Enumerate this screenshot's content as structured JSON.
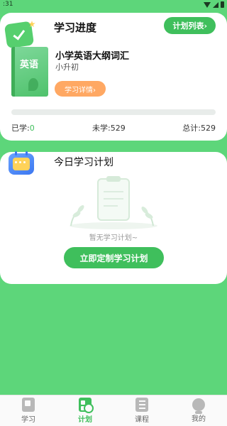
{
  "status_bar": {
    "time": ":31"
  },
  "progress": {
    "title": "学习进度",
    "plan_list_button": "计划列表›",
    "book": {
      "cover_label": "英语",
      "title": "小学英语大纲词汇",
      "subtitle": "小升初",
      "detail_button": "学习详情›"
    },
    "bar_fraction": 0,
    "learned_label": "已学:",
    "learned_value": "0",
    "unlearned": "未学:529",
    "total": "总计:529"
  },
  "plan": {
    "title": "今日学习计划",
    "empty_text": "暂无学习计划~",
    "create_button": "立即定制学习计划"
  },
  "tabs": [
    {
      "label": "学习",
      "icon": "book-icon",
      "active": false
    },
    {
      "label": "计划",
      "icon": "plan-icon",
      "active": true
    },
    {
      "label": "课程",
      "icon": "list-icon",
      "active": false
    },
    {
      "label": "我的",
      "icon": "profile-icon",
      "active": false
    }
  ],
  "colors": {
    "accent": "#3fbf5c",
    "background": "#5dd67a",
    "detail_button": "#ffa863"
  }
}
